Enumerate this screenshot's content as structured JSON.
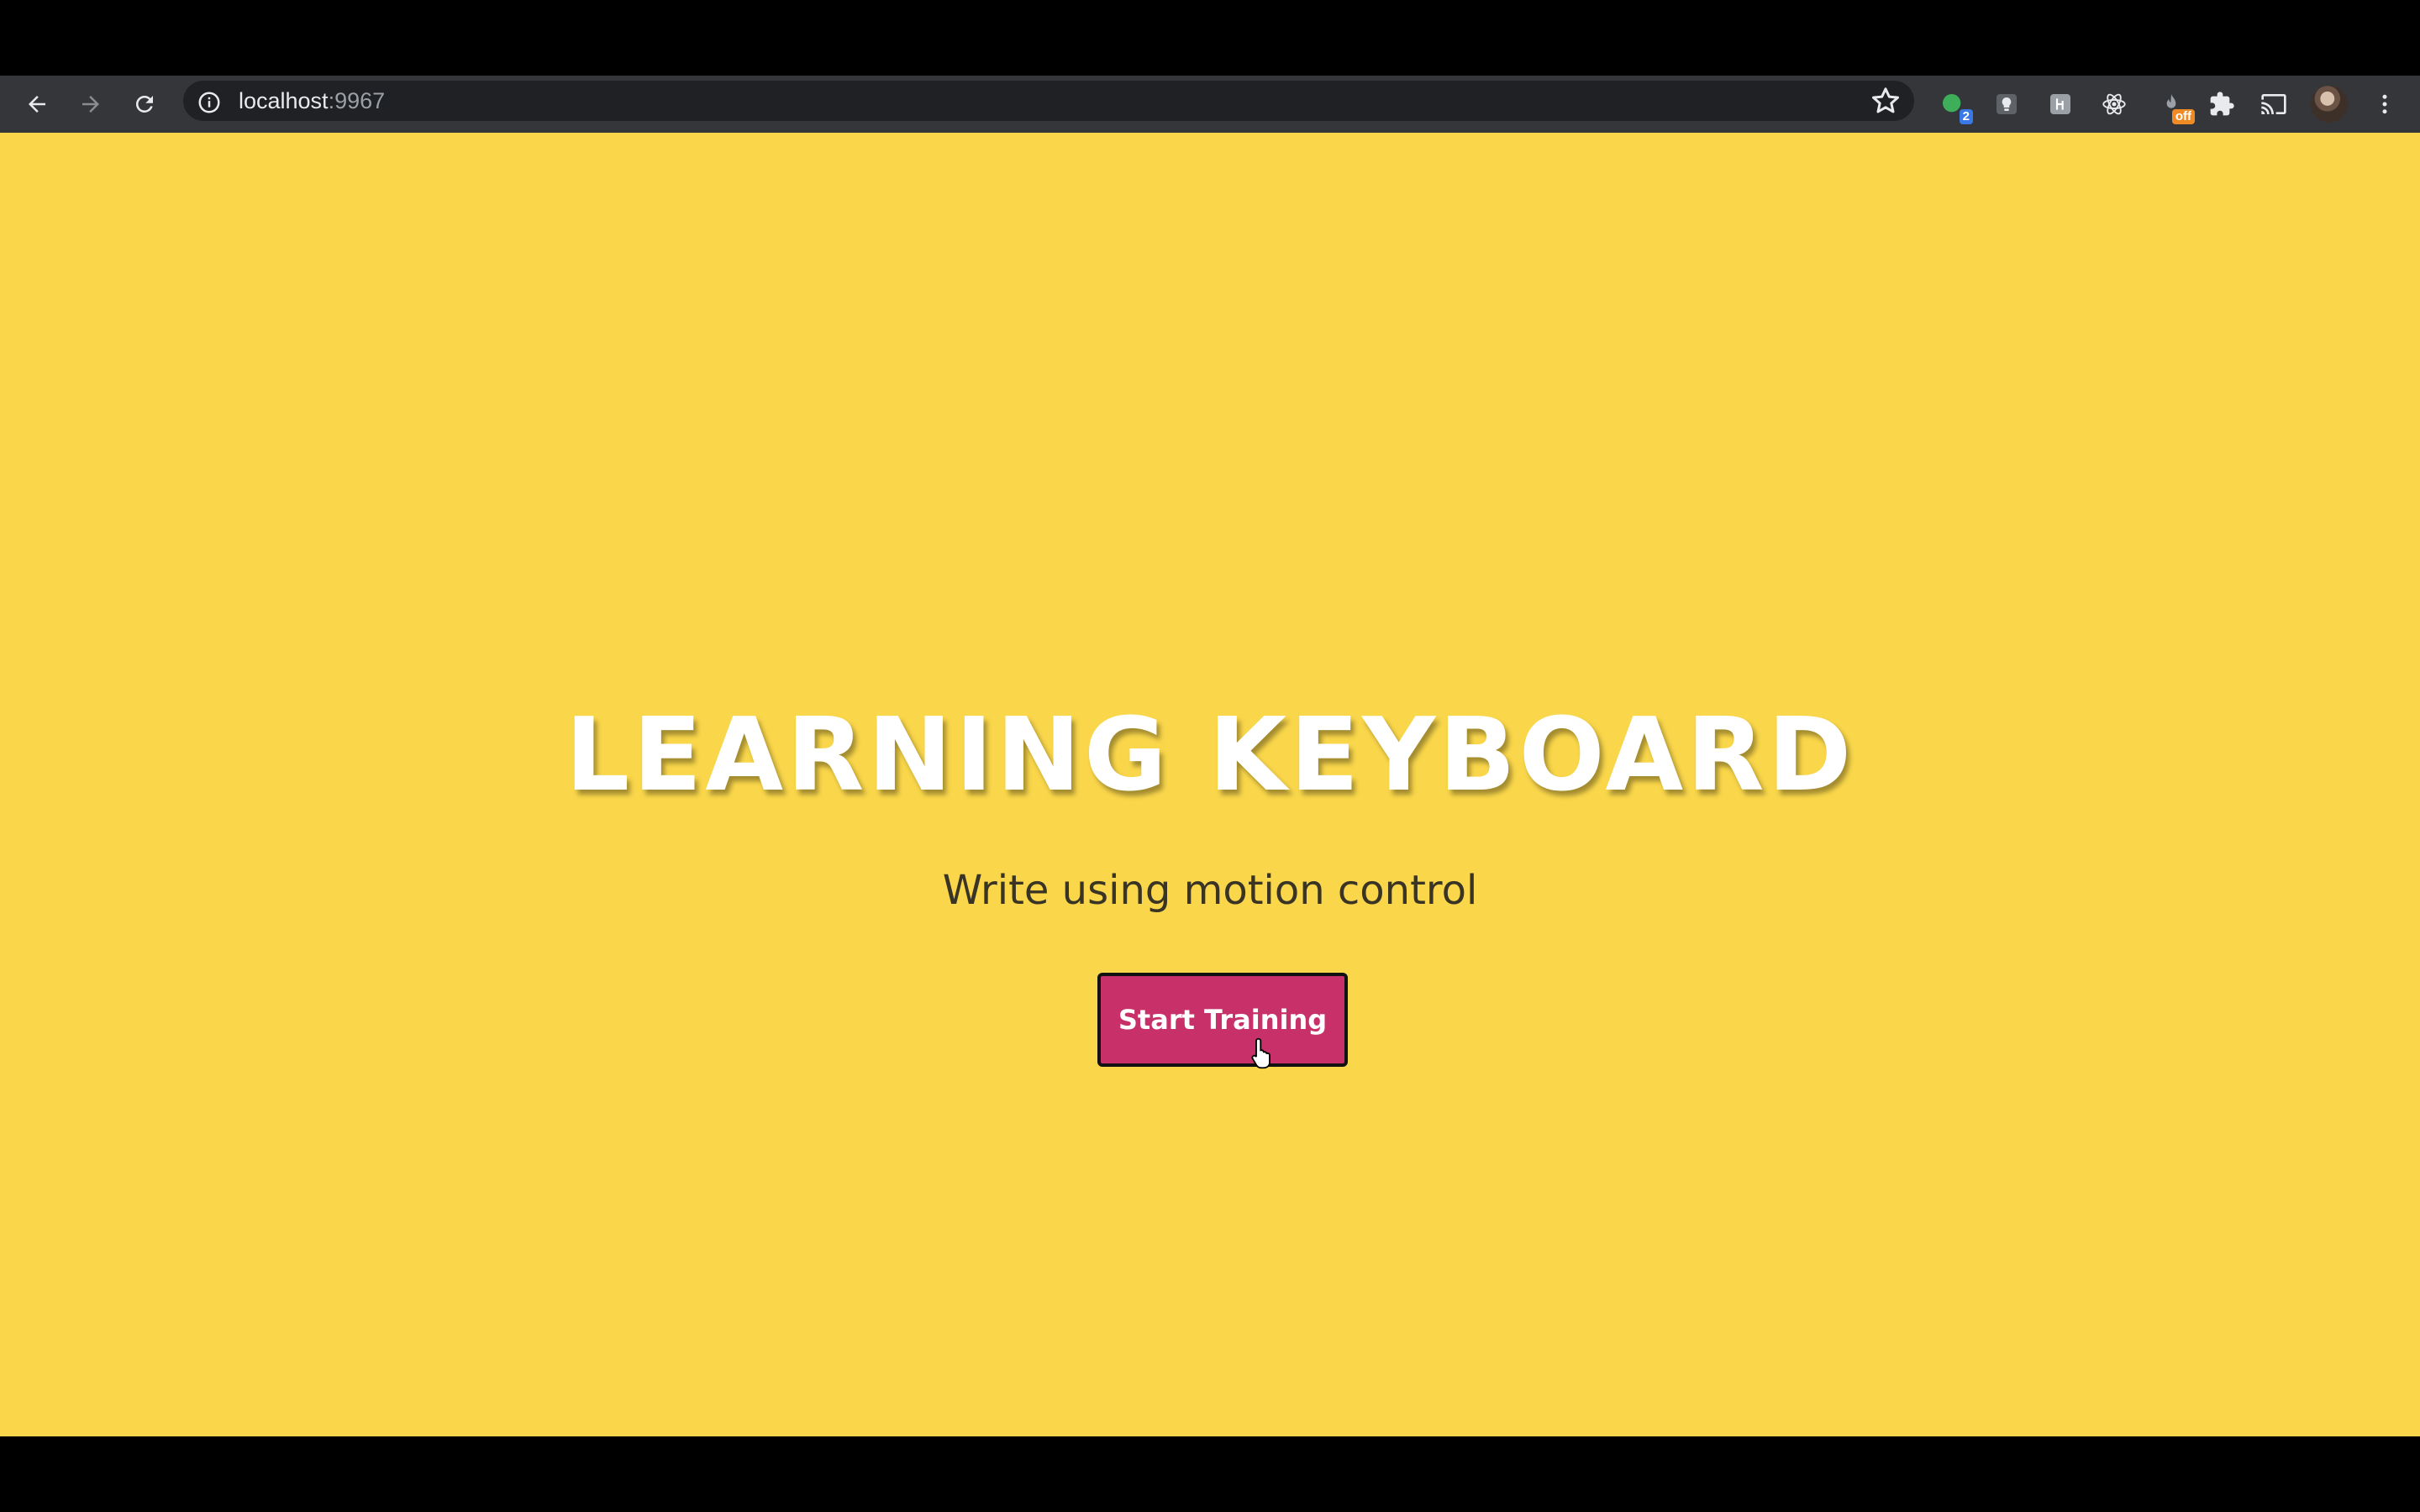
{
  "browser": {
    "url_host": "localhost",
    "url_port": ":9967",
    "extensions": [
      {
        "icon": "green-circle-extension-icon",
        "badge": "2",
        "badge_color": "#3b78e7"
      },
      {
        "icon": "lightbulb-extension-icon"
      },
      {
        "icon": "grey-square-extension-icon"
      },
      {
        "icon": "react-devtools-icon"
      },
      {
        "icon": "fire-extension-icon",
        "badge": "off",
        "badge_color": "#f08a24"
      },
      {
        "icon": "puzzle-extensions-icon"
      },
      {
        "icon": "cast-icon"
      }
    ]
  },
  "hero": {
    "title": "LEARNING KEYBOARD",
    "subtitle": "Write using motion control",
    "button_label": "Start Training"
  },
  "colors": {
    "page_background": "#f9d64a",
    "button_background": "#c8306a",
    "title_color": "#ffffff",
    "toolbar_background": "#35363a"
  }
}
